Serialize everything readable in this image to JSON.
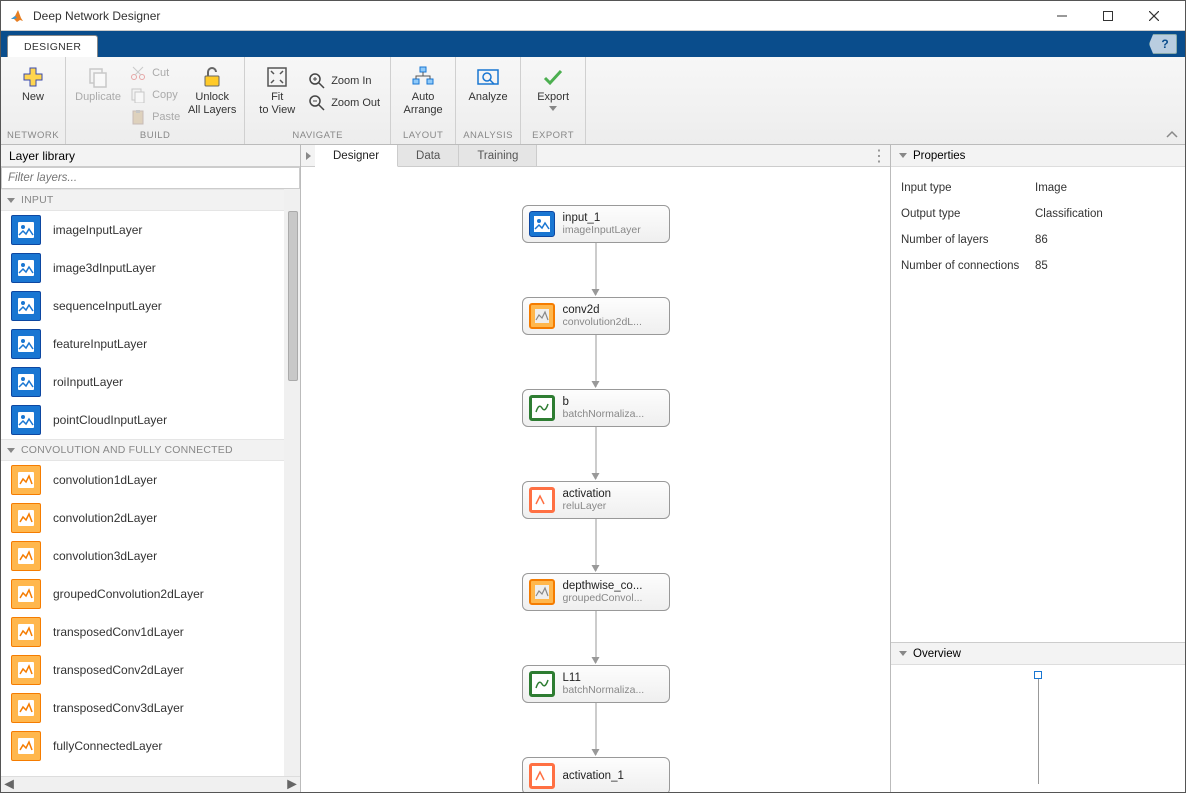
{
  "window": {
    "title": "Deep Network Designer"
  },
  "tabstrip": {
    "designer": "DESIGNER"
  },
  "toolstrip": {
    "groups": {
      "network": "NETWORK",
      "build": "BUILD",
      "navigate": "NAVIGATE",
      "layout": "LAYOUT",
      "analysis": "ANALYSIS",
      "export": "EXPORT"
    },
    "new": "New",
    "duplicate": "Duplicate",
    "cut": "Cut",
    "copy": "Copy",
    "paste": "Paste",
    "unlock": "Unlock",
    "unlock2": "All Layers",
    "fit": "Fit",
    "fit2": "to View",
    "zoomin": "Zoom In",
    "zoomout": "Zoom Out",
    "auto": "Auto",
    "auto2": "Arrange",
    "analyze": "Analyze",
    "export": "Export"
  },
  "library": {
    "title": "Layer library",
    "filter_placeholder": "Filter layers...",
    "cat_input": "INPUT",
    "cat_conv": "CONVOLUTION AND FULLY CONNECTED",
    "layers_input": [
      "imageInputLayer",
      "image3dInputLayer",
      "sequenceInputLayer",
      "featureInputLayer",
      "roiInputLayer",
      "pointCloudInputLayer"
    ],
    "layers_conv": [
      "convolution1dLayer",
      "convolution2dLayer",
      "convolution3dLayer",
      "groupedConvolution2dLayer",
      "transposedConv1dLayer",
      "transposedConv2dLayer",
      "transposedConv3dLayer",
      "fullyConnectedLayer"
    ]
  },
  "designer_tabs": {
    "designer": "Designer",
    "data": "Data",
    "training": "Training"
  },
  "nodes": [
    {
      "name": "input_1",
      "type": "imageInputLayer",
      "style": "blue"
    },
    {
      "name": "conv2d",
      "type": "convolution2dL...",
      "style": "orange"
    },
    {
      "name": "b",
      "type": "batchNormaliza...",
      "style": "green"
    },
    {
      "name": "activation",
      "type": "reluLayer",
      "style": "orange2"
    },
    {
      "name": "depthwise_co...",
      "type": "groupedConvol...",
      "style": "orange"
    },
    {
      "name": "L11",
      "type": "batchNormaliza...",
      "style": "green"
    },
    {
      "name": "activation_1",
      "type": "",
      "style": "orange2"
    }
  ],
  "properties": {
    "title": "Properties",
    "input_type_k": "Input type",
    "input_type_v": "Image",
    "output_type_k": "Output type",
    "output_type_v": "Classification",
    "nlayers_k": "Number of layers",
    "nlayers_v": "86",
    "nconn_k": "Number of connections",
    "nconn_v": "85"
  },
  "overview": {
    "title": "Overview"
  }
}
